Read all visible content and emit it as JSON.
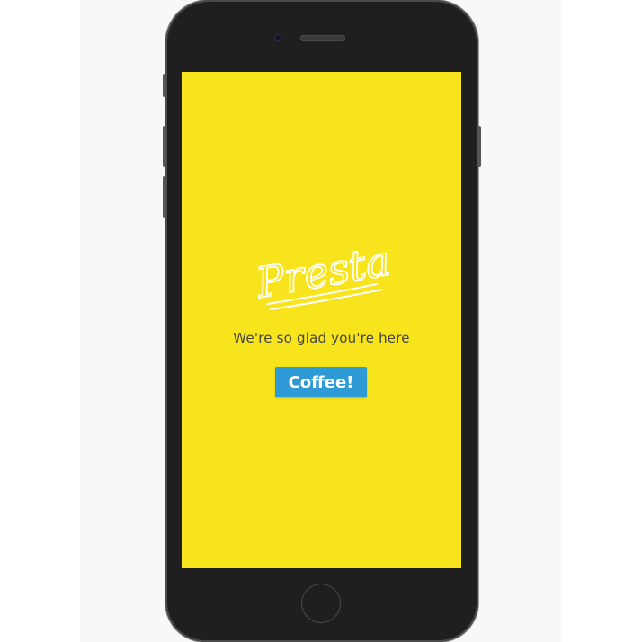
{
  "app": {
    "logo_text": "Presta",
    "tagline": "We're so glad you're here",
    "cta_label": "Coffee!"
  },
  "colors": {
    "screen_background": "#f8e41c",
    "button_background": "#2e9ad6",
    "button_text": "#ffffff",
    "tagline_text": "#444444",
    "logo": "#ffffff",
    "device_body": "#1f1f1f"
  },
  "icons": {
    "camera": "front-camera-icon",
    "speaker": "earpiece-icon",
    "home": "home-button-icon"
  }
}
